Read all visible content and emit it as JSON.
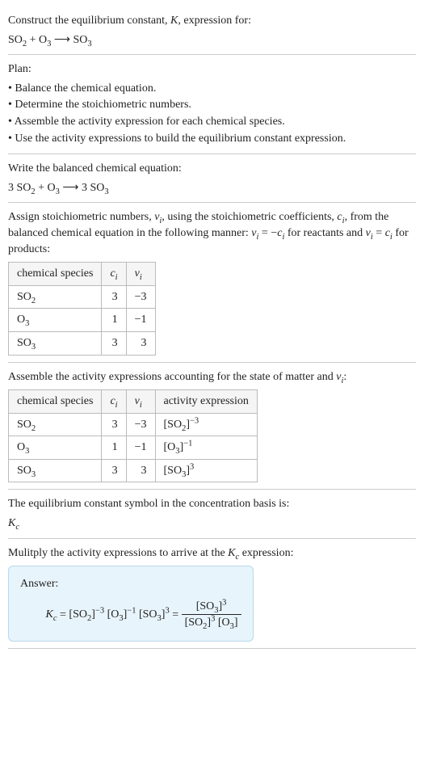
{
  "title_line1": "Construct the equilibrium constant, K, expression for:",
  "title_eq_lhs": "SO",
  "title_eq": "SO₂ + O₃ ⟶ SO₃",
  "plan_label": "Plan:",
  "plan_items": [
    "• Balance the chemical equation.",
    "• Determine the stoichiometric numbers.",
    "• Assemble the activity expression for each chemical species.",
    "• Use the activity expressions to build the equilibrium constant expression."
  ],
  "balanced_label": "Write the balanced chemical equation:",
  "balanced_eq": "3 SO₂ + O₃ ⟶ 3 SO₃",
  "stoich_intro_a": "Assign stoichiometric numbers, νᵢ, using the stoichiometric coefficients, cᵢ, from the balanced chemical equation in the following manner: νᵢ = −cᵢ for reactants and νᵢ = cᵢ for products:",
  "table1": {
    "headers": [
      "chemical species",
      "cᵢ",
      "νᵢ"
    ],
    "rows": [
      [
        "SO₂",
        "3",
        "−3"
      ],
      [
        "O₃",
        "1",
        "−1"
      ],
      [
        "SO₃",
        "3",
        "3"
      ]
    ]
  },
  "assemble_intro": "Assemble the activity expressions accounting for the state of matter and νᵢ:",
  "table2": {
    "headers": [
      "chemical species",
      "cᵢ",
      "νᵢ",
      "activity expression"
    ],
    "rows": [
      {
        "sp": "SO₂",
        "c": "3",
        "v": "−3",
        "act_base": "[SO₂]",
        "act_exp": "−3"
      },
      {
        "sp": "O₃",
        "c": "1",
        "v": "−1",
        "act_base": "[O₃]",
        "act_exp": "−1"
      },
      {
        "sp": "SO₃",
        "c": "3",
        "v": "3",
        "act_base": "[SO₃]",
        "act_exp": "3"
      }
    ]
  },
  "symbol_intro": "The equilibrium constant symbol in the concentration basis is:",
  "symbol_val": "K",
  "symbol_sub": "c",
  "multiply_intro": "Mulitply the activity expressions to arrive at the Kc expression:",
  "answer_label": "Answer:",
  "answer": {
    "kc_lhs": "Kc = ",
    "term1_base": "[SO₂]",
    "term1_exp": "−3",
    "term2_base": "[O₃]",
    "term2_exp": "−1",
    "term3_base": "[SO₃]",
    "term3_exp": "3",
    "frac_num_base": "[SO₃]",
    "frac_num_exp": "3",
    "frac_den_a_base": "[SO₂]",
    "frac_den_a_exp": "3",
    "frac_den_b_base": "[O₃]"
  }
}
